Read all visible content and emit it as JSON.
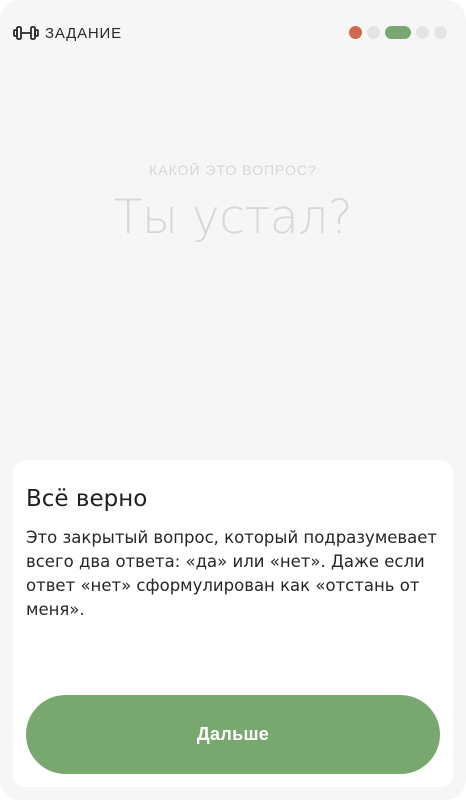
{
  "header": {
    "title": "ЗАДАНИЕ",
    "icon": "dumbbell-icon",
    "progress": {
      "total": 5,
      "current_index": 2,
      "colors": {
        "done": "#cf6a50",
        "current": "#79a770",
        "pending": "#e4e4e4"
      }
    }
  },
  "question": {
    "kind_label": "КАКОЙ ЭТО ВОПРОС?",
    "text": "Ты устал?"
  },
  "feedback": {
    "title": "Всё верно",
    "body": "Это закрытый вопрос, который подразумевает всего два ответа: «да» или «нет». Даже если ответ «нет» сформулирован как «отстань от меня».",
    "button_label": "Дальше"
  },
  "colors": {
    "accent": "#79a770",
    "error_dot": "#cf6a50",
    "background": "#f6f6f6",
    "card": "#ffffff"
  }
}
